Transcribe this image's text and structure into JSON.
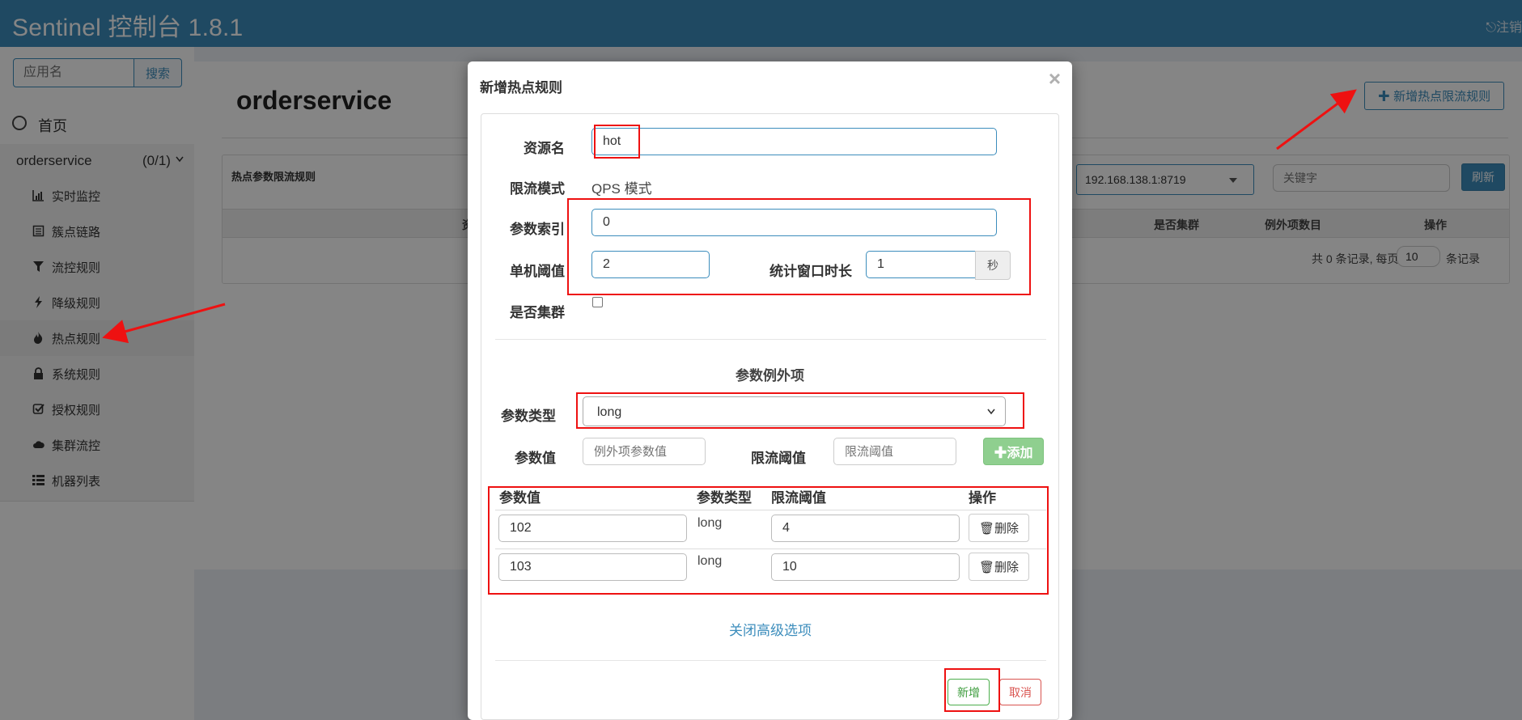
{
  "header": {
    "title": "Sentinel 控制台 1.8.1",
    "logout_label": "注销"
  },
  "sidebar": {
    "search_placeholder": "应用名",
    "search_button": "搜索",
    "home_label": "首页",
    "app_name": "orderservice",
    "app_count": "(0/1)",
    "items": [
      {
        "label": "实时监控",
        "icon": "bar-chart-icon"
      },
      {
        "label": "簇点链路",
        "icon": "list-icon"
      },
      {
        "label": "流控规则",
        "icon": "filter-icon"
      },
      {
        "label": "降级规则",
        "icon": "bolt-icon"
      },
      {
        "label": "热点规则",
        "icon": "fire-icon"
      },
      {
        "label": "系统规则",
        "icon": "lock-icon"
      },
      {
        "label": "授权规则",
        "icon": "check-square-icon"
      },
      {
        "label": "集群流控",
        "icon": "cloud-icon"
      },
      {
        "label": "机器列表",
        "icon": "th-list-icon"
      }
    ]
  },
  "main": {
    "page_title": "orderservice",
    "add_button": "新增热点限流规则",
    "rules_title": "热点参数限流规则",
    "machine_select": "192.168.138.1:8719",
    "keyword_placeholder": "关键字",
    "refresh_button": "刷新",
    "table_headers": {
      "col1": "资",
      "cluster": "是否集群",
      "exceptions": "例外项数目",
      "actions": "操作"
    },
    "pager_prefix": "共 0 条记录, 每页",
    "page_size": "10",
    "pager_suffix": "条记录"
  },
  "modal": {
    "title": "新增热点规则",
    "close": "×",
    "resource_label": "资源名",
    "resource_value": "hot",
    "mode_label": "限流模式",
    "mode_value": "QPS 模式",
    "param_index_label": "参数索引",
    "param_index_value": "0",
    "threshold_label": "单机阈值",
    "threshold_value": "2",
    "window_label": "统计窗口时长",
    "window_value": "1",
    "window_unit": "秒",
    "cluster_label": "是否集群",
    "exceptions_title": "参数例外项",
    "param_type_label": "参数类型",
    "param_type_value": "long",
    "param_value_label": "参数值",
    "param_value_placeholder": "例外项参数值",
    "limit_label": "限流阈值",
    "limit_placeholder": "限流阈值",
    "add_button": "添加",
    "table_headers": {
      "value": "参数值",
      "type": "参数类型",
      "limit": "限流阈值",
      "action": "操作"
    },
    "rows": [
      {
        "value": "102",
        "type": "long",
        "limit": "4",
        "delete": "删除"
      },
      {
        "value": "103",
        "type": "long",
        "limit": "10",
        "delete": "删除"
      }
    ],
    "advanced_link": "关闭高级选项",
    "save_button": "新增",
    "cancel_button": "取消"
  }
}
